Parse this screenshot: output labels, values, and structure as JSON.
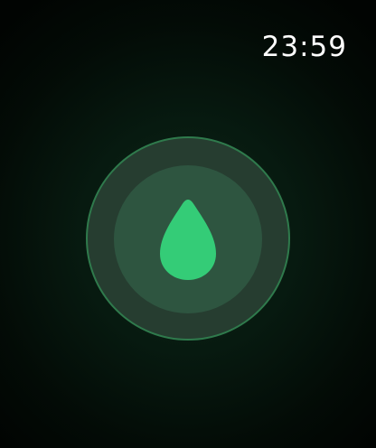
{
  "status_bar": {
    "time": "23:59"
  },
  "water_lock": {
    "icon": "water-drop-icon",
    "accent_color": "#34cc77",
    "ring_color": "#2f7a4c"
  }
}
